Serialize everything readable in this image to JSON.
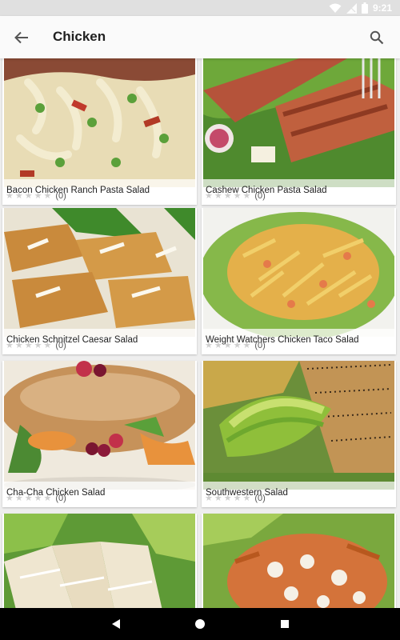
{
  "status_bar": {
    "time": "9:21",
    "icons": [
      "wifi-icon",
      "signal-icon",
      "battery-icon"
    ]
  },
  "app_bar": {
    "title": "Chicken",
    "back_icon": "arrow-left-icon",
    "search_icon": "search-icon"
  },
  "recipes": [
    {
      "title": "Bacon Chicken Ranch Pasta Salad",
      "stars": 5,
      "rating": 0,
      "review_count": "(0)"
    },
    {
      "title": "Cashew Chicken Pasta Salad",
      "stars": 5,
      "rating": 0,
      "review_count": "(0)"
    },
    {
      "title": "Chicken Schnitzel Caesar Salad",
      "stars": 5,
      "rating": 0,
      "review_count": "(0)"
    },
    {
      "title": "Weight Watchers Chicken Taco Salad",
      "stars": 5,
      "rating": 0,
      "review_count": "(0)"
    },
    {
      "title": "Cha-Cha Chicken Salad",
      "stars": 5,
      "rating": 0,
      "review_count": "(0)"
    },
    {
      "title": "Southwestern Salad",
      "stars": 5,
      "rating": 0,
      "review_count": "(0)"
    },
    {
      "title": "",
      "stars": 5,
      "rating": 0,
      "review_count": ""
    },
    {
      "title": "",
      "stars": 5,
      "rating": 0,
      "review_count": ""
    }
  ],
  "nav_bar": {
    "buttons": [
      "back-triangle-icon",
      "home-circle-icon",
      "recents-square-icon"
    ]
  },
  "colors": {
    "status_bar": "#e0e0e0",
    "app_bar": "#fafafa",
    "star_empty": "#cfcfcf",
    "nav_bar": "#000000"
  }
}
